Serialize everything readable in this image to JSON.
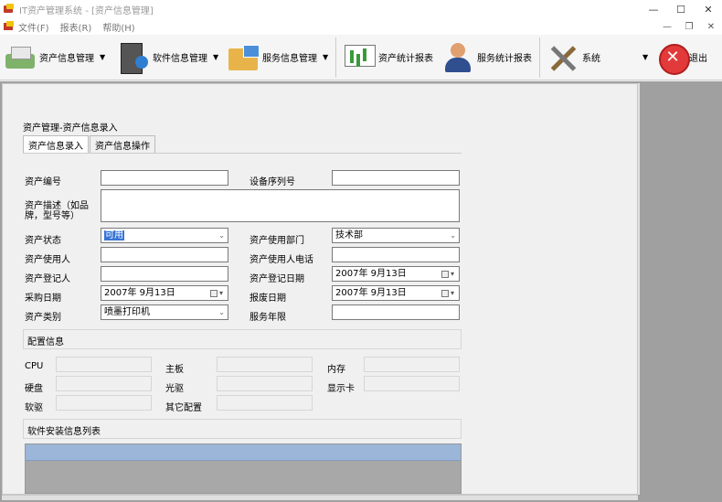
{
  "window": {
    "title": "IT资产管理系统 - [资产信息管理]",
    "controls": {
      "minimize": "—",
      "maximize": "☐",
      "close": "✕"
    }
  },
  "menu": {
    "items": [
      "文件(F)",
      "报表(R)",
      "帮助(H)"
    ],
    "mdi_controls": {
      "minimize": "—",
      "restore": "❐",
      "close": "✕"
    }
  },
  "toolbar": {
    "asset_mgmt": "资产信息管理",
    "software_mgmt": "软件信息管理",
    "service_mgmt": "服务信息管理",
    "asset_stats": "资产统计报表",
    "service_stats": "服务统计报表",
    "system": "系统",
    "exit": "退出",
    "dropdown_glyph": "▼"
  },
  "form": {
    "breadcrumb": "资产管理-资产信息录入",
    "tabs": [
      "资产信息录入",
      "资产信息操作"
    ],
    "labels": {
      "asset_no": "资产编号",
      "device_serial": "设备序列号",
      "asset_desc_line1": "资产描述（如品",
      "asset_desc_line2": "牌，型号等）",
      "asset_status": "资产状态",
      "use_dept": "资产使用部门",
      "user": "资产使用人",
      "user_phone": "资产使用人电话",
      "registrar": "资产登记人",
      "reg_date": "资产登记日期",
      "purchase_date": "采购日期",
      "scrap_date": "报废日期",
      "category": "资产类别",
      "service_years": "服务年限"
    },
    "values": {
      "asset_no": "",
      "device_serial": "",
      "asset_desc": "",
      "asset_status": "可用",
      "use_dept": "技术部",
      "user": "",
      "user_phone": "",
      "registrar": "",
      "reg_date": "2007年  9月13日",
      "purchase_date": "2007年  9月13日",
      "scrap_date": "2007年  9月13日",
      "category": "喷墨打印机",
      "service_years": ""
    },
    "dropdown_glyph": "⌄",
    "cal_glyph": "▾"
  },
  "config": {
    "section_title": "配置信息",
    "labels": {
      "cpu": "CPU",
      "motherboard": "主板",
      "memory": "内存",
      "disk": "硬盘",
      "optical": "光驱",
      "display_card": "显示卡",
      "floppy": "软驱",
      "other": "其它配置"
    }
  },
  "software": {
    "section_title": "软件安装信息列表"
  }
}
